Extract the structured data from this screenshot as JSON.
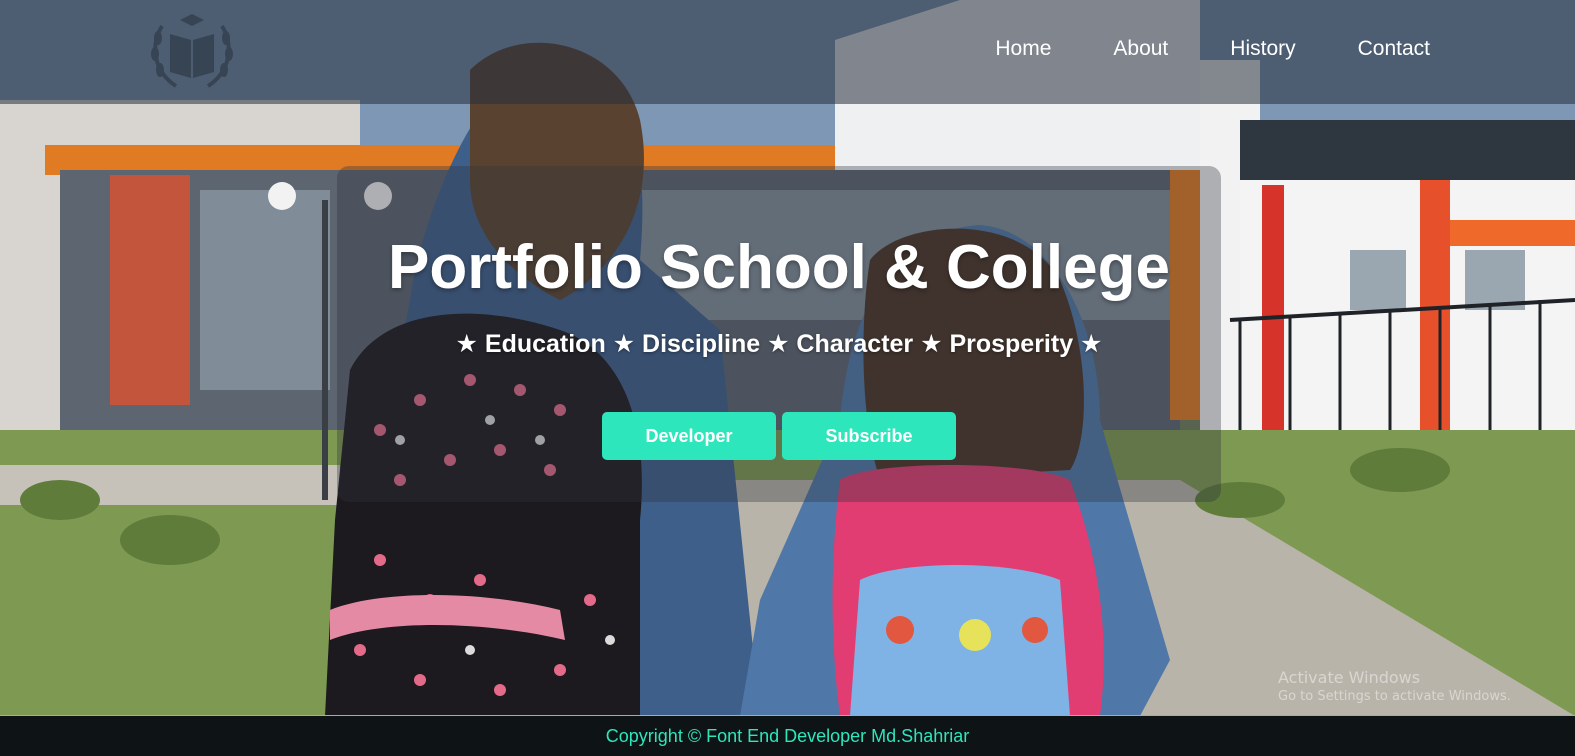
{
  "nav": {
    "logo": "book-laurel-logo",
    "links": [
      "Home",
      "About",
      "History",
      "Contact"
    ]
  },
  "hero": {
    "title": "Portfolio School & College",
    "tagline": "★ Education ★ Discipline ★ Character ★ Prosperity ★",
    "buttons": {
      "developer": "Developer",
      "subscribe": "Subscribe"
    }
  },
  "background": {
    "description_icon": "school-photo-background"
  },
  "watermark": {
    "title": "Activate Windows",
    "subtitle": "Go to Settings to activate Windows."
  },
  "footer": {
    "copyright": "Copyright © Font End Developer Md.Shahriar"
  },
  "colors": {
    "accent": "#2ee6bc",
    "footer_bg": "#0e1316",
    "nav_bg": "rgba(40,48,60,0.55)"
  }
}
